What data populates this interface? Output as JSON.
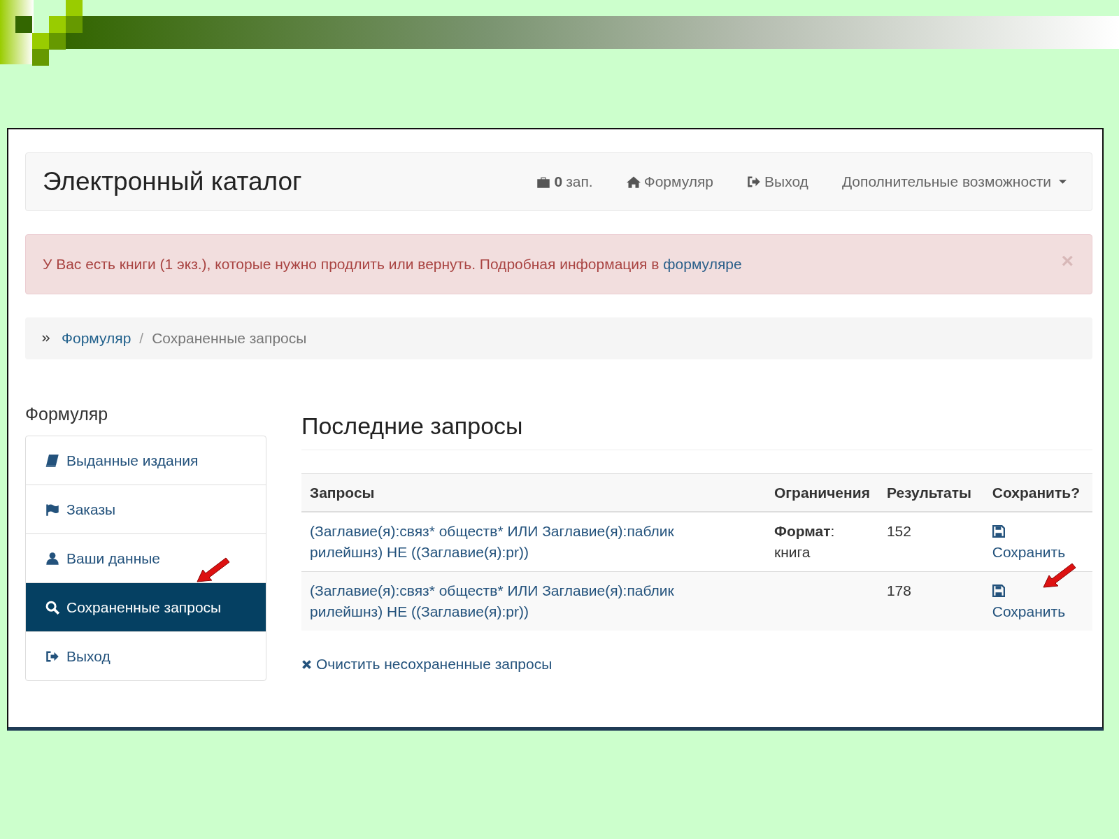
{
  "navbar": {
    "brand": "Электронный каталог",
    "links": [
      {
        "kind": "basket",
        "count": "0",
        "label": "зап."
      },
      {
        "kind": "home",
        "label": "Формуляр"
      },
      {
        "kind": "exit",
        "label": "Выход"
      },
      {
        "kind": "dropdown",
        "label": "Дополнительные возможности"
      }
    ]
  },
  "alert": {
    "text": "У Вас есть книги (1 экз.), которые нужно продлить или вернуть. Подробная информация в ",
    "link": "формуляре",
    "close": "×"
  },
  "breadcrumb": {
    "separator": "/",
    "items": [
      {
        "label": "Формуляр",
        "selected": false
      },
      {
        "label": "Сохраненные запросы",
        "selected": true
      }
    ]
  },
  "sidebar": {
    "title": "Формуляр",
    "items": [
      {
        "kind": "book",
        "label": "Выданные издания",
        "selected": false
      },
      {
        "kind": "flag",
        "label": "Заказы",
        "selected": false
      },
      {
        "kind": "user",
        "label": "Ваши данные",
        "selected": false
      },
      {
        "kind": "search",
        "label": "Сохраненные запросы",
        "selected": true
      },
      {
        "kind": "exit",
        "label": "Выход",
        "selected": false
      }
    ]
  },
  "main": {
    "title": "Последние запросы",
    "table": {
      "columns": [
        "Запросы",
        "Ограничения",
        "Результаты",
        "Сохранить?"
      ],
      "rows": [
        {
          "query": "(Заглавие(я):связ* обществ* ИЛИ Заглавие(я):паблик рилейшнз) НЕ ((Заглавие(я):pr))",
          "limits": "**Формат**: книга",
          "results": "152",
          "action": "Сохранить"
        },
        {
          "query": "(Заглавие(я):связ* обществ* ИЛИ Заглавие(я):паблик рилейшнз) НЕ ((Заглавие(я):pr))",
          "limits": "",
          "results": "178",
          "action": "Сохранить"
        }
      ]
    },
    "clear_link": "Очистить несохраненные запросы"
  }
}
